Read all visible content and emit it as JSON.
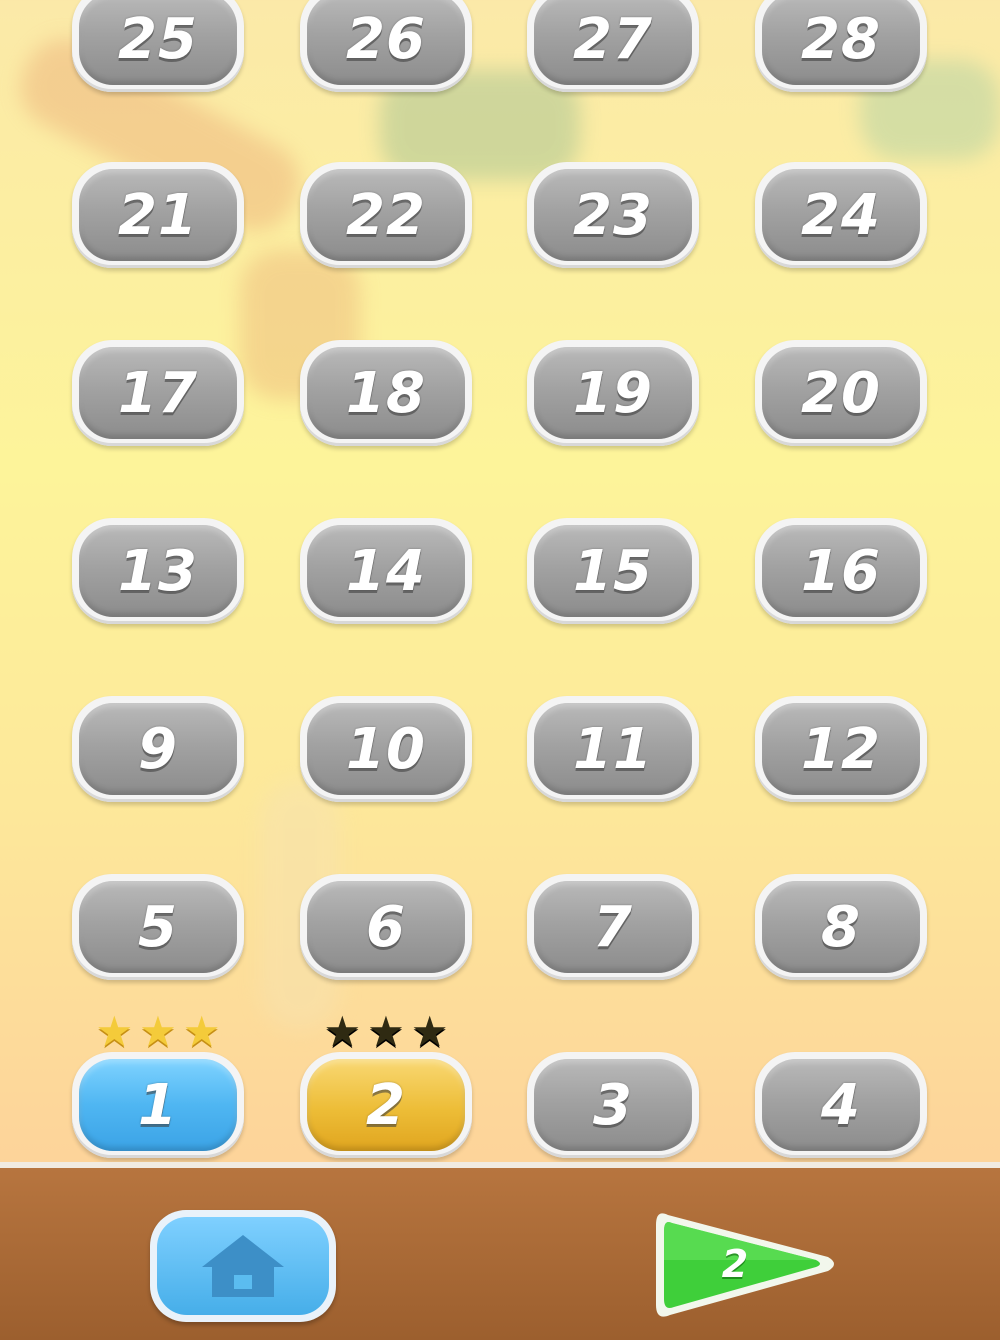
{
  "levels": [
    {
      "label": "25",
      "state": "locked"
    },
    {
      "label": "26",
      "state": "locked"
    },
    {
      "label": "27",
      "state": "locked"
    },
    {
      "label": "28",
      "state": "locked"
    },
    {
      "label": "21",
      "state": "locked"
    },
    {
      "label": "22",
      "state": "locked"
    },
    {
      "label": "23",
      "state": "locked"
    },
    {
      "label": "24",
      "state": "locked"
    },
    {
      "label": "17",
      "state": "locked"
    },
    {
      "label": "18",
      "state": "locked"
    },
    {
      "label": "19",
      "state": "locked"
    },
    {
      "label": "20",
      "state": "locked"
    },
    {
      "label": "13",
      "state": "locked"
    },
    {
      "label": "14",
      "state": "locked"
    },
    {
      "label": "15",
      "state": "locked"
    },
    {
      "label": "16",
      "state": "locked"
    },
    {
      "label": "9",
      "state": "locked"
    },
    {
      "label": "10",
      "state": "locked"
    },
    {
      "label": "11",
      "state": "locked"
    },
    {
      "label": "12",
      "state": "locked"
    },
    {
      "label": "5",
      "state": "locked"
    },
    {
      "label": "6",
      "state": "locked"
    },
    {
      "label": "7",
      "state": "locked"
    },
    {
      "label": "8",
      "state": "locked"
    },
    {
      "label": "1",
      "state": "completed",
      "stars_earned": 3,
      "stars_total": 3
    },
    {
      "label": "2",
      "state": "current",
      "stars_earned": 0,
      "stars_total": 3
    },
    {
      "label": "3",
      "state": "locked"
    },
    {
      "label": "4",
      "state": "locked"
    }
  ],
  "footer": {
    "home_icon": "home-icon",
    "next_label": "2",
    "next_icon": "play-triangle-icon"
  },
  "colors": {
    "locked": "#a2a2a2",
    "completed": "#4fb6f2",
    "current": "#edbd37",
    "star_earned": "#f4cb3a",
    "star_unearned": "#2f2a12",
    "footer_wood": "#9c5f2e",
    "play_green": "#3fcf3a"
  }
}
